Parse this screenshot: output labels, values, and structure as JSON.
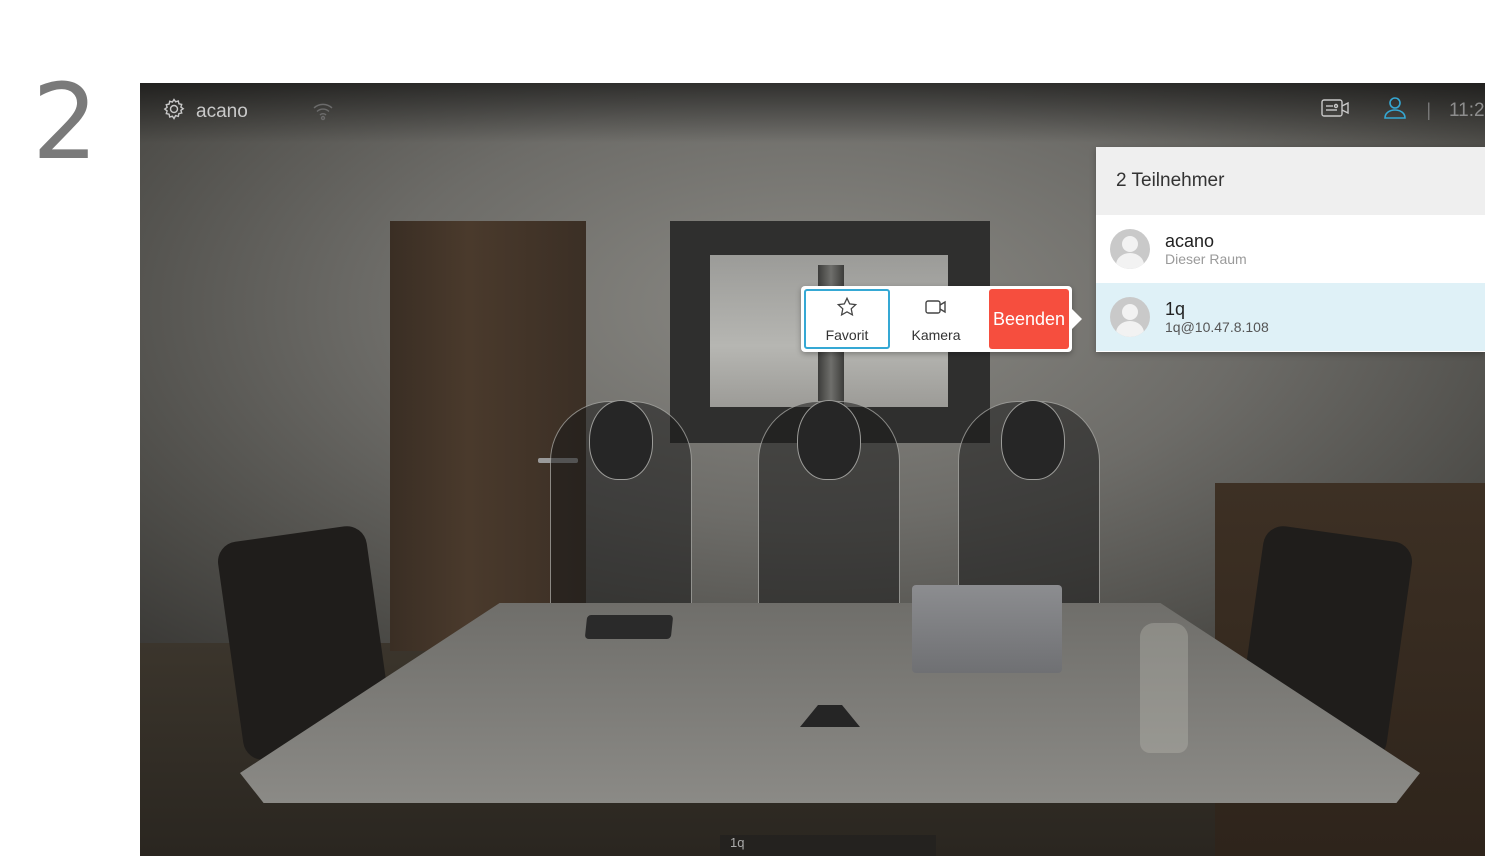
{
  "step": {
    "number": "2"
  },
  "topbar": {
    "system_name": "acano",
    "clock": "11:2"
  },
  "participants": {
    "header": "2 Teilnehmer",
    "items": [
      {
        "name": "acano",
        "detail": "Dieser Raum"
      },
      {
        "name": "1q",
        "detail": "1q@10.47.8.108"
      }
    ]
  },
  "actions": {
    "favorite": "Favorit",
    "camera": "Kamera",
    "end": "Beenden"
  },
  "video_overlay": {
    "name_tag": "1q"
  },
  "colors": {
    "accent": "#35a8d4",
    "end_button": "#f64e3e",
    "selected_row": "#dff1f7"
  },
  "icons": [
    "gear-icon",
    "wifi-icon",
    "camera-control-icon",
    "person-icon",
    "star-icon",
    "video-camera-icon"
  ]
}
